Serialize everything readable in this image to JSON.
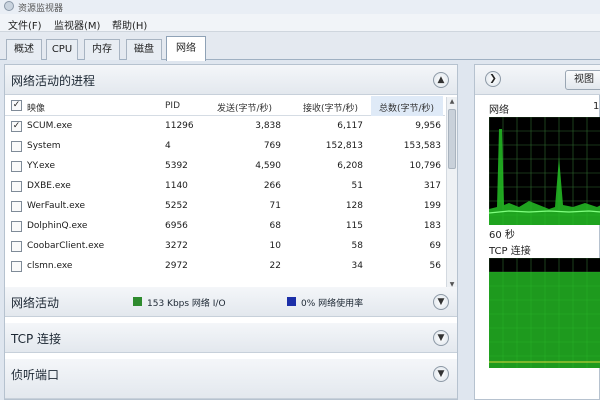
{
  "window": {
    "title": "资源监视器"
  },
  "menu": [
    {
      "label": "文件(F)"
    },
    {
      "label": "监视器(M)"
    },
    {
      "label": "帮助(H)"
    }
  ],
  "tabs": [
    {
      "label": "概述"
    },
    {
      "label": "CPU"
    },
    {
      "label": "内存"
    },
    {
      "label": "磁盘"
    },
    {
      "label": "网络",
      "active": true
    }
  ],
  "sections": {
    "network_processes": {
      "title": "网络活动的进程"
    },
    "network_activity": {
      "title": "网络活动",
      "legend": [
        {
          "text": "153 Kbps 网络 I/O",
          "color": "#2e8b2e"
        },
        {
          "text": "0% 网络使用率",
          "color": "#1c2fa8"
        }
      ]
    },
    "tcp": {
      "title": "TCP 连接"
    },
    "listening": {
      "title": "侦听端口"
    }
  },
  "table": {
    "columns": [
      "映像",
      "PID",
      "发送(字节/秒)",
      "接收(字节/秒)",
      "总数(字节/秒)"
    ],
    "rows": [
      {
        "name": "SCUM.exe",
        "pid": "11296",
        "send": "3,838",
        "recv": "6,117",
        "total": "9,956",
        "checked": true
      },
      {
        "name": "System",
        "pid": "4",
        "send": "769",
        "recv": "152,813",
        "total": "153,583",
        "checked": false
      },
      {
        "name": "YY.exe",
        "pid": "5392",
        "send": "4,590",
        "recv": "6,208",
        "total": "10,796",
        "checked": false
      },
      {
        "name": "DXBE.exe",
        "pid": "1140",
        "send": "266",
        "recv": "51",
        "total": "317",
        "checked": false
      },
      {
        "name": "WerFault.exe",
        "pid": "5252",
        "send": "71",
        "recv": "128",
        "total": "199",
        "checked": false
      },
      {
        "name": "DolphinQ.exe",
        "pid": "6956",
        "send": "68",
        "recv": "115",
        "total": "183",
        "checked": false
      },
      {
        "name": "CoobarClient.exe",
        "pid": "3272",
        "send": "10",
        "recv": "58",
        "total": "69",
        "checked": false
      },
      {
        "name": "clsmn.exe",
        "pid": "2972",
        "send": "22",
        "recv": "34",
        "total": "56",
        "checked": false
      }
    ]
  },
  "right": {
    "view_label": "视图",
    "network_label": "网络",
    "network_value": "1",
    "time_label": "60 秒",
    "tcp_label": "TCP 连接"
  },
  "colors": {
    "graph_green": "#25c025",
    "graph_line": "#7fff7f",
    "grid": "#2f6b2f"
  }
}
